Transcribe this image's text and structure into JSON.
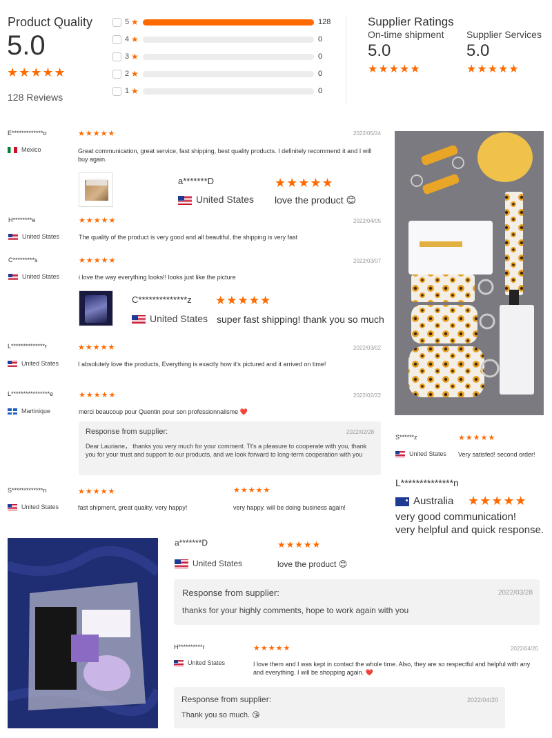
{
  "summary": {
    "title": "Product Quality",
    "score": "5.0",
    "reviews_label": "128 Reviews",
    "bars": [
      {
        "star": "5",
        "count": "128",
        "fraction": 1.0
      },
      {
        "star": "4",
        "count": "0",
        "fraction": 0
      },
      {
        "star": "3",
        "count": "0",
        "fraction": 0
      },
      {
        "star": "2",
        "count": "0",
        "fraction": 0
      },
      {
        "star": "1",
        "count": "0",
        "fraction": 0
      }
    ]
  },
  "supplier": {
    "title": "Supplier Ratings",
    "shipment_label": "On-time shipment",
    "shipment_score": "5.0",
    "services_label": "Supplier Services",
    "services_score": "5.0"
  },
  "stars": "★★★★★",
  "reviews": [
    {
      "name": "E*************o",
      "country": "Mexico",
      "date": "2022/05/24",
      "text": "Great communication, great service, fast shipping, best quality products. I definitely recommend it and I will buy again."
    },
    {
      "name": "H********e",
      "country": "United States",
      "date": "2022/04/05",
      "text": "The quality of the product is very good and all beautiful, the shipping is very fast"
    },
    {
      "name": "C*********s",
      "country": "United States",
      "date": "2022/03/07",
      "text": "i love the way everything looks!! looks just like the picture"
    },
    {
      "name": "L**************r",
      "country": "United States",
      "date": "2022/03/02",
      "text": "I absolutely love the products, Everything is exactly how it's pictured and it arrived on time!"
    },
    {
      "name": "L****************e",
      "country": "Martinique",
      "date": "2022/02/22",
      "text": "merci beaucoup pour Quentin pour son professionnalisme ❤️"
    },
    {
      "name": "S*************n",
      "country": "United States",
      "text": "fast shipment, great quality, very happy!"
    }
  ],
  "extra_review_text": "very happy. will be doing business again!",
  "overlay_review_1": {
    "name": "a*******D",
    "country": "United States",
    "text": "love the product 😊"
  },
  "overlay_review_2": {
    "name": "C**************z",
    "country": "United States",
    "text": "super fast shipping! thank you so much"
  },
  "martinique_reply": {
    "label": "Response from supplier:",
    "date": "2022/02/28",
    "text": "Dear Lauriane， thanks you very much for your comment. Tt's a pleasure to cooperate with you, thank you for your trust and support to our products, and we look forward to long-term cooperation with you"
  },
  "right_review_1": {
    "name": "S******z",
    "country": "United States",
    "text": "Very satisfed! second order!"
  },
  "right_review_2": {
    "name": "L**************n",
    "country": "Australia",
    "text_line1": "very good communication!",
    "text_line2": "very helpful and quick response."
  },
  "bottom_review_1": {
    "name": "a*******D",
    "country": "United States",
    "text": "love the product 😊",
    "reply_label": "Response from supplier:",
    "reply_date": "2022/03/28",
    "reply_text": "thanks for your highly comments, hope to work again with you"
  },
  "bottom_review_2": {
    "name": "H**********r",
    "country": "United States",
    "date": "2022/04/20",
    "text": "I love them and I was kept in contact the whole time. Also, they are so respectful and helpful with any and everything. I will be shopping again. ❤️",
    "reply_label": "Response from supplier:",
    "reply_date": "2022/04/20",
    "reply_text": "Thank you so much. 😘"
  }
}
